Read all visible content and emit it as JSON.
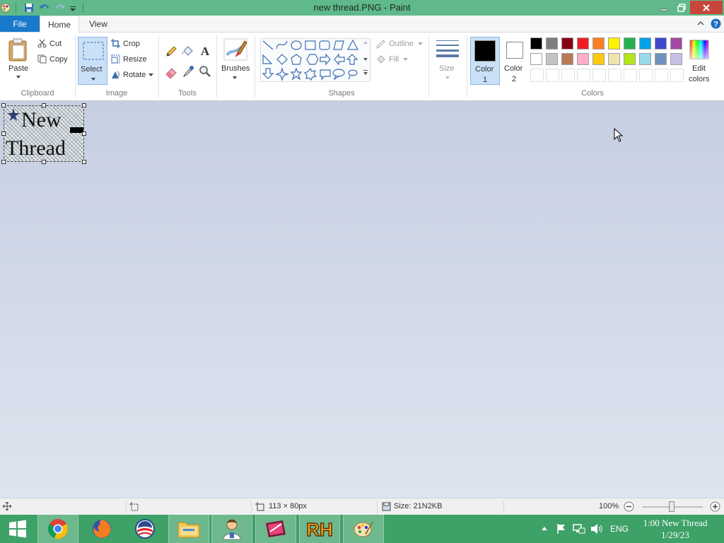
{
  "window": {
    "title": "new thread.PNG - Paint"
  },
  "tabs": {
    "file": "File",
    "home": "Home",
    "view": "View"
  },
  "ribbon": {
    "clipboard": {
      "paste": "Paste",
      "cut": "Cut",
      "copy": "Copy",
      "label": "Clipboard"
    },
    "image": {
      "select": "Select",
      "crop": "Crop",
      "resize": "Resize",
      "rotate": "Rotate",
      "label": "Image"
    },
    "tools": {
      "label": "Tools"
    },
    "brushes": {
      "label": "Brushes"
    },
    "shapes": {
      "outline": "Outline",
      "fill": "Fill",
      "label": "Shapes"
    },
    "size": {
      "label": "Size"
    },
    "colors": {
      "color1_a": "Color",
      "color1_b": "1",
      "color2_a": "Color",
      "color2_b": "2",
      "edit_a": "Edit",
      "edit_b": "colors",
      "label": "Colors",
      "row1": [
        "#000000",
        "#7f7f7f",
        "#880015",
        "#ed1c24",
        "#ff7f27",
        "#fff200",
        "#22b14c",
        "#00a2e8",
        "#3f48cc",
        "#a349a4"
      ],
      "row2": [
        "#ffffff",
        "#c3c3c3",
        "#b97a57",
        "#ffaec9",
        "#ffc90e",
        "#efe4b0",
        "#b5e61d",
        "#99d9ea",
        "#7092be",
        "#c8bfe7"
      ]
    }
  },
  "canvas": {
    "image_text_line1": "New",
    "image_text_line2": "Thread"
  },
  "status": {
    "dimensions": "113 × 80px",
    "size": "Size: 21N2KB",
    "zoom": "100%"
  },
  "taskbar": {
    "apps": [
      "windows-start",
      "chrome",
      "firefox",
      "obama-app",
      "file-explorer",
      "user-app",
      "media-app",
      "rh-app",
      "paint"
    ],
    "lang": "ENG",
    "time": "1:00 New Thread",
    "date": "1/29/23"
  }
}
